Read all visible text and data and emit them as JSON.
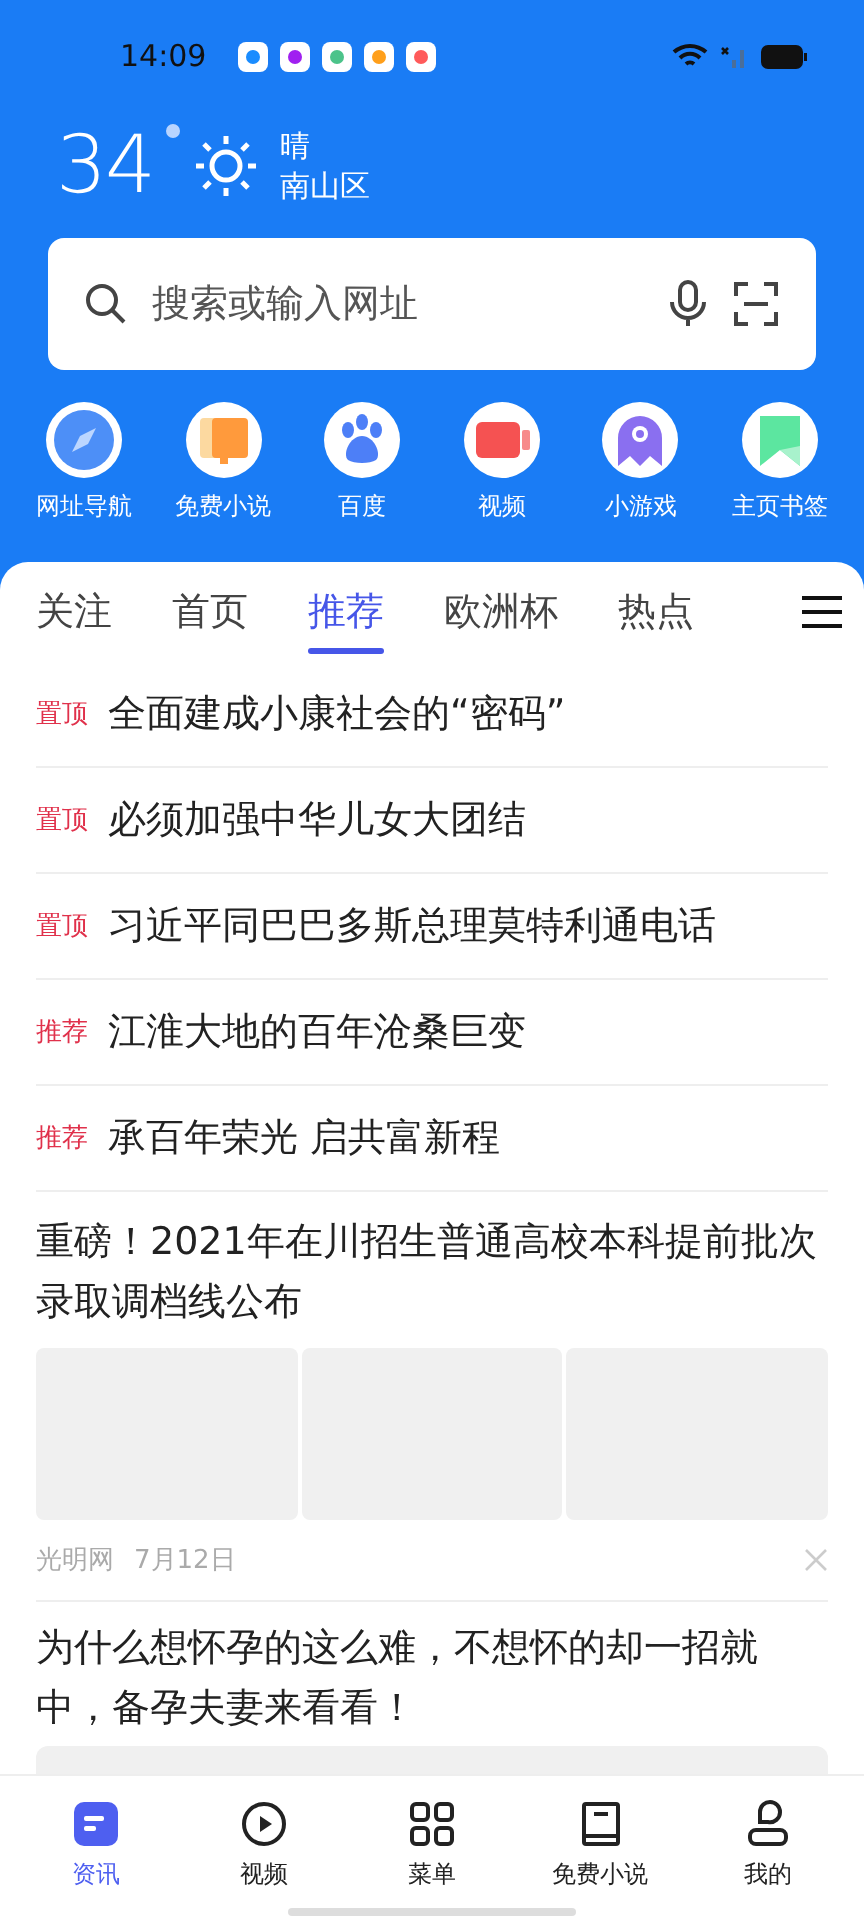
{
  "status_bar": {
    "time": "14:09"
  },
  "weather": {
    "temperature": "34",
    "condition": "晴",
    "location": "南山区"
  },
  "search": {
    "placeholder": "搜索或输入网址"
  },
  "shortcuts": [
    {
      "label": "网址导航"
    },
    {
      "label": "免费小说"
    },
    {
      "label": "百度"
    },
    {
      "label": "视频"
    },
    {
      "label": "小游戏"
    },
    {
      "label": "主页书签"
    }
  ],
  "tabs": [
    {
      "label": "关注",
      "selected": false
    },
    {
      "label": "首页",
      "selected": false
    },
    {
      "label": "推荐",
      "selected": true
    },
    {
      "label": "欧洲杯",
      "selected": false
    },
    {
      "label": "热点",
      "selected": false
    }
  ],
  "feed": [
    {
      "kind": "headline",
      "tag": "置顶",
      "title": "全面建成小康社会的“密码”"
    },
    {
      "kind": "headline",
      "tag": "置顶",
      "title": "必须加强中华儿女大团结"
    },
    {
      "kind": "headline",
      "tag": "置顶",
      "title": "习近平同巴巴多斯总理莫特利通电话"
    },
    {
      "kind": "headline",
      "tag": "推荐",
      "title": "江淮大地的百年沧桑巨变"
    },
    {
      "kind": "headline",
      "tag": "推荐",
      "title": "承百年荣光 启共富新程"
    },
    {
      "kind": "gallery",
      "title": "重磅！2021年在川招生普通高校本科提前批次录取调档线公布",
      "source": "光明网",
      "date": "7月12日"
    },
    {
      "kind": "single",
      "title": "为什么想怀孕的这么难，不想怀的却一招就中，备孕夫妻来看看！"
    }
  ],
  "bottom_nav": [
    {
      "label": "资讯",
      "selected": true
    },
    {
      "label": "视频",
      "selected": false
    },
    {
      "label": "菜单",
      "selected": false
    },
    {
      "label": "免费小说",
      "selected": false
    },
    {
      "label": "我的",
      "selected": false
    }
  ]
}
